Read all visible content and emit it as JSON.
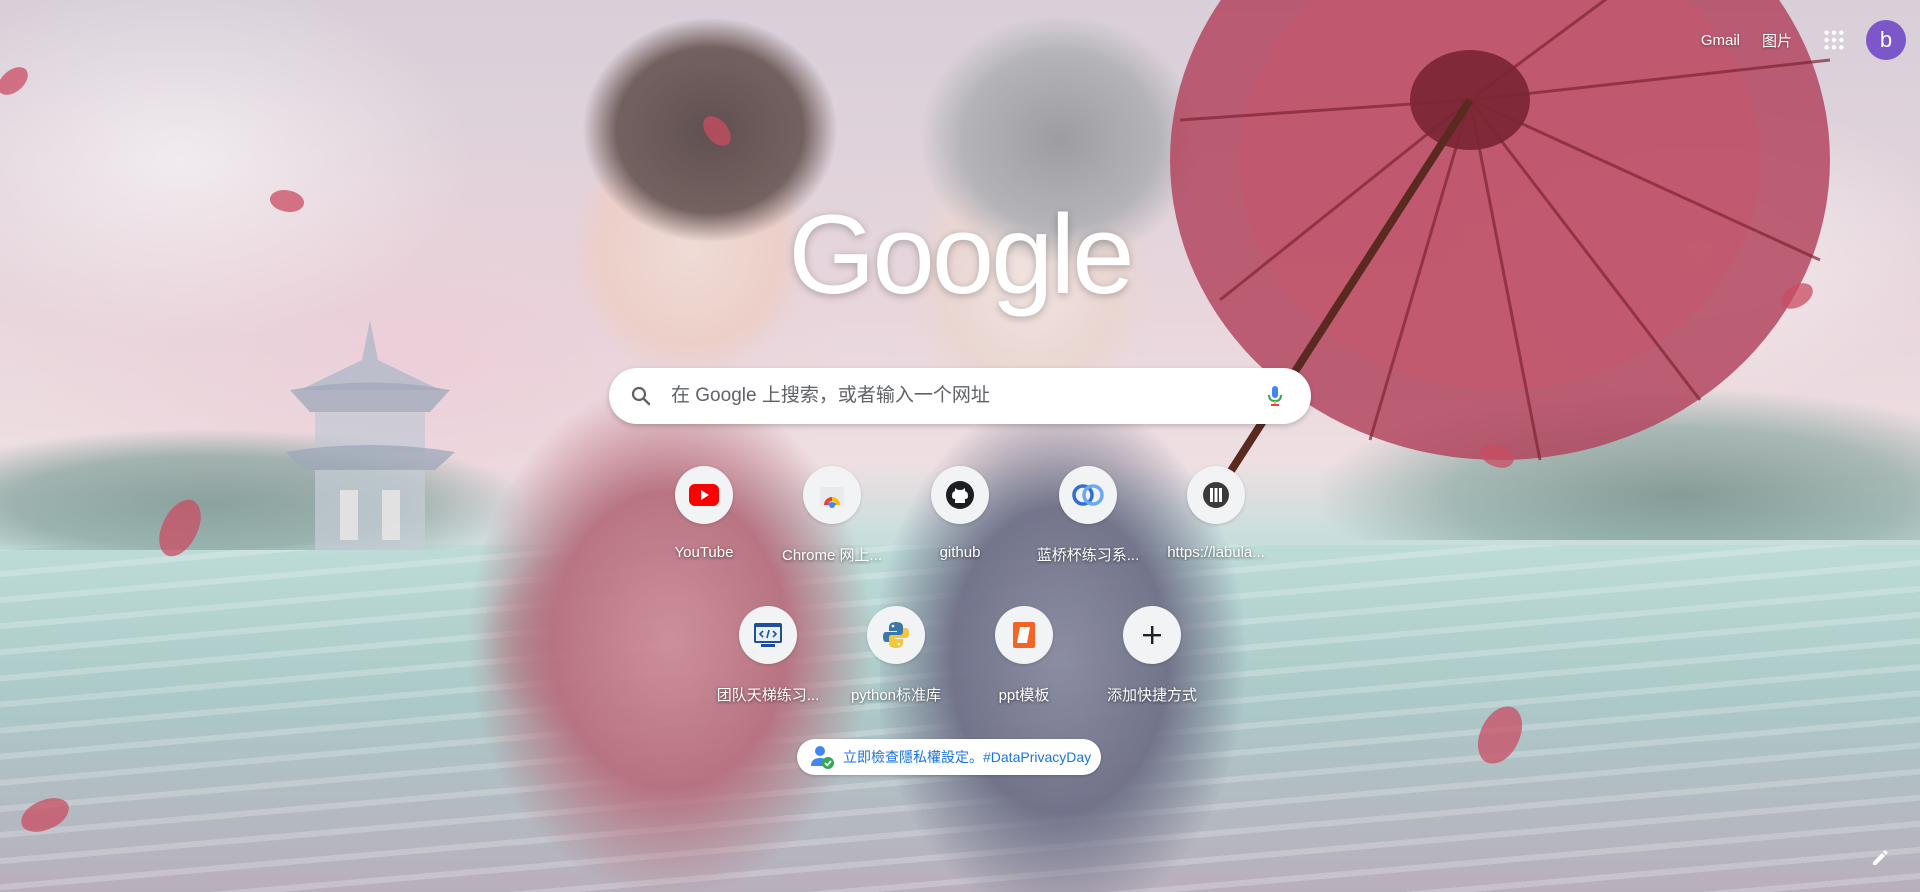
{
  "header": {
    "gmail_label": "Gmail",
    "images_label": "图片",
    "avatar_letter": "b",
    "avatar_color": "#7b57c9"
  },
  "logo": {
    "text": "Google"
  },
  "search": {
    "placeholder": "在 Google 上搜索，或者输入一个网址",
    "value": ""
  },
  "shortcuts": [
    {
      "label": "YouTube",
      "icon": "youtube-icon"
    },
    {
      "label": "Chrome 网上...",
      "icon": "chrome-web-store-icon"
    },
    {
      "label": "github",
      "icon": "github-icon"
    },
    {
      "label": "蓝桥杯练习系...",
      "icon": "lanqiao-icon"
    },
    {
      "label": "https://labula...",
      "icon": "labuladong-icon"
    },
    {
      "label": "团队天梯练习...",
      "icon": "code-window-icon"
    },
    {
      "label": "python标准库",
      "icon": "python-icon"
    },
    {
      "label": "ppt模板",
      "icon": "ppt-template-icon"
    },
    {
      "label": "添加快捷方式",
      "icon": "plus-icon"
    }
  ],
  "promo": {
    "text": "立即檢查隱私權設定。#DataPrivacyDay"
  }
}
